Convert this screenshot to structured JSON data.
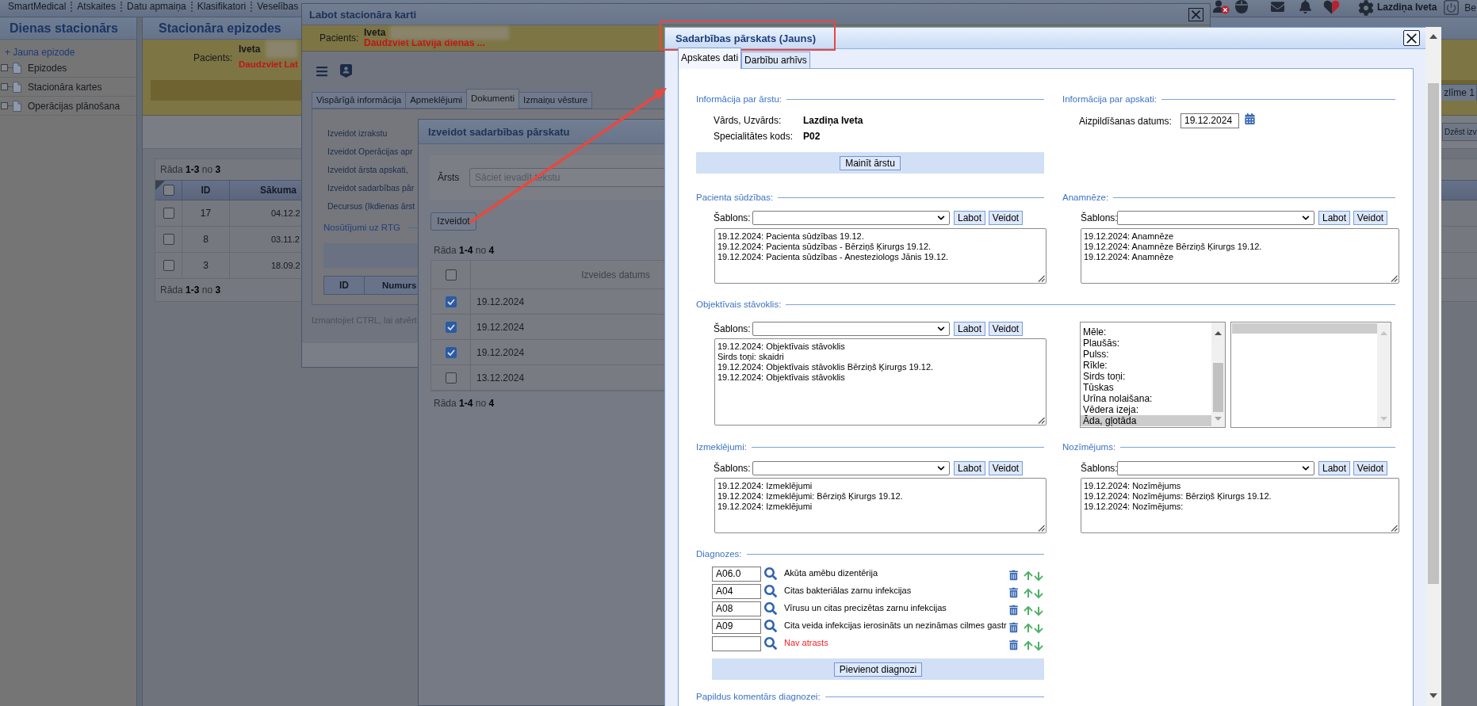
{
  "menu_bar": {
    "items": [
      "SmartMedical",
      "Atskaites",
      "Datu apmaiņa",
      "Klasifikatori",
      "Veselības"
    ],
    "user_name": "Lazdiņa Iveta",
    "trailing_text": "Be"
  },
  "sidebar": {
    "title": "Dienas stacionārs",
    "new_link": "+ Jauna epizode",
    "items": [
      {
        "label": "Epizodes"
      },
      {
        "label": "Stacionāra kartes"
      },
      {
        "label": "Operācijas plānošana"
      }
    ]
  },
  "main": {
    "title": "Stacionāra epizodes",
    "patient": {
      "label": "Pacients:",
      "first_name": "Iveta",
      "program": "Daudzviet Lat"
    },
    "sticker_tab": "zlīme 1",
    "delete_button": "Dzēst izv",
    "table": {
      "pager_top": [
        {
          "text": "Rāda",
          "muted": true
        },
        {
          "text": "1-3",
          "muted": false
        },
        {
          "text": "no",
          "muted": true
        },
        {
          "text": "3",
          "muted": false
        }
      ],
      "header_checked": false,
      "columns": [
        "ID",
        "Sākuma"
      ],
      "rows": [
        {
          "checked": false,
          "id": "17",
          "date": "04.12.2"
        },
        {
          "checked": false,
          "id": "8",
          "date": "03.11.2"
        },
        {
          "checked": false,
          "id": "3",
          "date": "18.09.2"
        }
      ],
      "pager_bottom": [
        {
          "text": "Rāda",
          "muted": true
        },
        {
          "text": "1-3",
          "muted": false
        },
        {
          "text": "no",
          "muted": true
        },
        {
          "text": "3",
          "muted": false
        }
      ]
    }
  },
  "record_dialog": {
    "title": "Labot stacionāra karti",
    "patient": {
      "label": "Pacients:",
      "first_name": "Iveta",
      "program": "Daudzviet Latvija dienas ..."
    },
    "tabs": [
      {
        "label": "Vispārīgā informācija",
        "selected": false
      },
      {
        "label": "Apmeklējumi",
        "selected": false
      },
      {
        "label": "Dokumenti",
        "selected": true
      },
      {
        "label": "Izmaiņu vēsture",
        "selected": false
      }
    ],
    "links": [
      "Izveidot izrakstu",
      "Izveidot Operācijas apr",
      "Izveidot ārsta apskati,",
      "Izveidot sadarbības pār",
      "Decursus (Ikdienas ārst"
    ],
    "section_legend": "Nosūtījumi uz RTG",
    "table_columns": [
      "ID",
      "Numurs"
    ],
    "hint": "Izmantojiet CTRL, lai atvērt"
  },
  "create_dialog": {
    "title": "Izveidot sadarbības pārskatu",
    "doctor_label": "Ārsts",
    "doctor_placeholder": "Sāciet ievadīt tekstu",
    "create_button": "Izveidot",
    "pager_top": [
      {
        "text": "Rāda",
        "muted": true
      },
      {
        "text": "1-4",
        "muted": false
      },
      {
        "text": "no",
        "muted": true
      },
      {
        "text": "4",
        "muted": false
      }
    ],
    "header_checked": false,
    "column": "Izveides datums",
    "rows": [
      {
        "checked": true,
        "date": "19.12.2024"
      },
      {
        "checked": true,
        "date": "19.12.2024"
      },
      {
        "checked": true,
        "date": "19.12.2024"
      },
      {
        "checked": false,
        "date": "13.12.2024"
      }
    ],
    "pager_bottom": [
      {
        "text": "Rāda",
        "muted": true
      },
      {
        "text": "1-4",
        "muted": false
      },
      {
        "text": "no",
        "muted": true
      },
      {
        "text": "4",
        "muted": false
      }
    ]
  },
  "report_dialog": {
    "title": "Sadarbības pārskats (Jauns)",
    "tabs": [
      {
        "label": "Apskates dati",
        "selected": true
      },
      {
        "label": "Darbību arhīvs",
        "selected": false
      }
    ],
    "doctor_info": {
      "legend": "Informācija par ārstu:",
      "fields": [
        {
          "label": "Vārds, Uzvārds:",
          "value": "Lazdiņa Iveta"
        },
        {
          "label": "Specialitātes kods:",
          "value": "P02"
        }
      ],
      "button": "Mainīt ārstu"
    },
    "exam_info": {
      "legend": "Informācija par apskati:",
      "date_label": "Aizpildīšanas datums:",
      "date_value": "19.12.2024"
    },
    "complaints": {
      "legend": "Pacienta sūdzības:",
      "template_label": "Šablons:",
      "edit_button": "Labot",
      "create_button": "Veidot",
      "lines": [
        "19.12.2024: Pacienta sūdzības 19.12.",
        "19.12.2024: Pacienta sūdzības - Bērziņš Ķirurgs 19.12.",
        "19.12.2024: Pacienta sūdzības - Anesteziologs Jānis 19.12."
      ]
    },
    "anamnesis": {
      "legend": "Anamnēze:",
      "template_label": "Šablons:",
      "edit_button": "Labot",
      "create_button": "Veidot",
      "lines": [
        "19.12.2024: Anamnēze",
        "19.12.2024: Anamnēze Bērziņš Ķirurgs 19.12.",
        "19.12.2024: Anamnēze"
      ]
    },
    "objective": {
      "legend": "Objektīvais stāvoklis:",
      "template_label": "Šablons:",
      "edit_button": "Labot",
      "create_button": "Veidot",
      "lines": [
        "19.12.2024: Objektīvais stāvoklis",
        "Sirds toņi: skaidri",
        "19.12.2024: Objektīvais stāvoklis Bērziņš Ķirurgs 19.12.",
        "19.12.2024: Objektīvais stāvoklis"
      ],
      "options": [
        {
          "label": "Mēle:",
          "selected": false
        },
        {
          "label": "Plaušās:",
          "selected": false
        },
        {
          "label": "Pulss:",
          "selected": false
        },
        {
          "label": "Rīkle:",
          "selected": false
        },
        {
          "label": "Sirds toņi:",
          "selected": false
        },
        {
          "label": "Tūskas",
          "selected": false
        },
        {
          "label": "Urīna nolaišana:",
          "selected": false
        },
        {
          "label": "Vēdera izeja:",
          "selected": false
        },
        {
          "label": "Āda, gļotāda",
          "selected": true
        }
      ],
      "second_list": {
        "rows": [
          {
            "selected": true
          }
        ]
      }
    },
    "investigations": {
      "legend": "Izmeklējumi:",
      "template_label": "Šablons:",
      "edit_button": "Labot",
      "create_button": "Veidot",
      "lines": [
        "19.12.2024: Izmeklējumi",
        "19.12.2024: Izmeklējumi: Bērziņš Ķirurgs 19.12.",
        "19.12.2024: Izmeklējumi"
      ]
    },
    "prescriptions": {
      "legend": "Nozīmējums:",
      "template_label": "Šablons:",
      "edit_button": "Labot",
      "create_button": "Veidot",
      "lines": [
        "19.12.2024: Nozīmējums",
        "19.12.2024: Nozīmējums: Bērziņš Ķirurgs 19.12.",
        "19.12.2024: Nozīmējums:"
      ]
    },
    "diagnoses": {
      "legend": "Diagnozes:",
      "rows": [
        {
          "code": "A06.0",
          "name": "Akūta amēbu dizentērija",
          "found": true
        },
        {
          "code": "A04",
          "name": "Citas bakteriālas zarnu infekcijas",
          "found": true
        },
        {
          "code": "A08",
          "name": "Vīrusu un citas precizētas zarnu infekcijas",
          "found": true
        },
        {
          "code": "A09",
          "name": "Cita veida infekcijas ierosināts un nezināmas cilmes gastr",
          "found": true
        },
        {
          "name": "Nav atrasts",
          "found": false
        }
      ],
      "add_button": "Pievienot diagnozi"
    },
    "comment": {
      "legend": "Papildus komentārs diagnozei:"
    }
  }
}
